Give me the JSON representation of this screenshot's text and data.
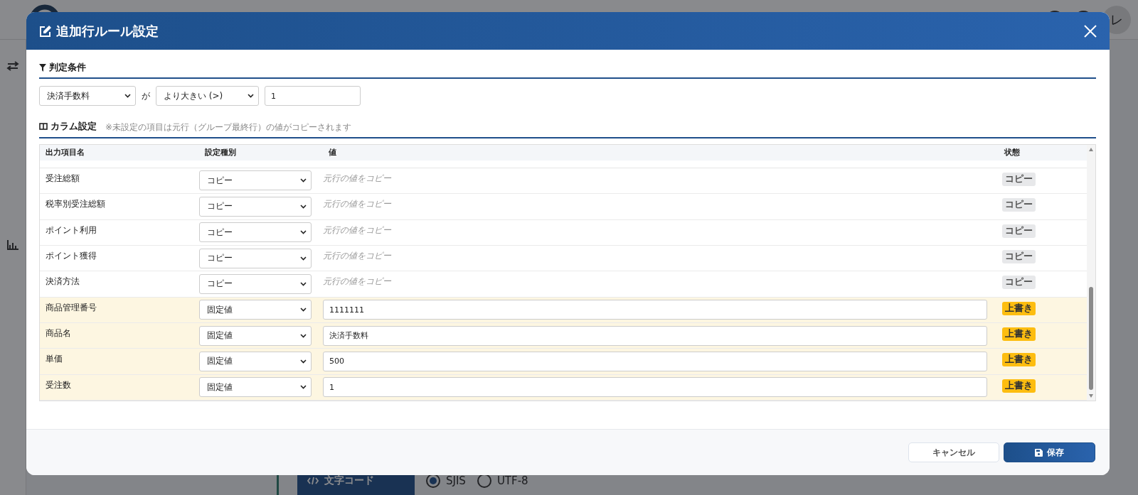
{
  "background": {
    "avatar": "レ",
    "encoding": {
      "label": "文字コード",
      "options": [
        {
          "label": "SJIS",
          "selected": true
        },
        {
          "label": "UTF-8",
          "selected": false
        }
      ]
    }
  },
  "dialog": {
    "title": "追加行ルール設定",
    "condition": {
      "title": "判定条件",
      "field": "決済手数料",
      "connector": "が",
      "operator": "より大きい (>)",
      "value": "1"
    },
    "columns_section": {
      "title": "カラム設定",
      "note": "※未設定の項目は元行（グループ最終行）の値がコピーされます",
      "columns": [
        "出力項目名",
        "設定種別",
        "値",
        "状態"
      ],
      "rows": [
        {
          "name": "受注総額",
          "kind": "copy",
          "type": "コピー",
          "value": "元行の値をコピー",
          "status": "コピー"
        },
        {
          "name": "税率別受注総額",
          "kind": "copy",
          "type": "コピー",
          "value": "元行の値をコピー",
          "status": "コピー"
        },
        {
          "name": "ポイント利用",
          "kind": "copy",
          "type": "コピー",
          "value": "元行の値をコピー",
          "status": "コピー"
        },
        {
          "name": "ポイント獲得",
          "kind": "copy",
          "type": "コピー",
          "value": "元行の値をコピー",
          "status": "コピー"
        },
        {
          "name": "決済方法",
          "kind": "copy",
          "type": "コピー",
          "value": "元行の値をコピー",
          "status": "コピー"
        },
        {
          "name": "商品管理番号",
          "kind": "fixed",
          "type": "固定値",
          "value": "1111111",
          "status": "上書き"
        },
        {
          "name": "商品名",
          "kind": "fixed",
          "type": "固定値",
          "value": "決済手数料",
          "status": "上書き"
        },
        {
          "name": "単価",
          "kind": "fixed",
          "type": "固定値",
          "value": "500",
          "status": "上書き"
        },
        {
          "name": "受注数",
          "kind": "fixed",
          "type": "固定値",
          "value": "1",
          "status": "上書き"
        }
      ]
    },
    "buttons": [
      {
        "label": "キャンセル",
        "kind": "secondary"
      },
      {
        "label": "保存",
        "kind": "primary"
      }
    ]
  }
}
